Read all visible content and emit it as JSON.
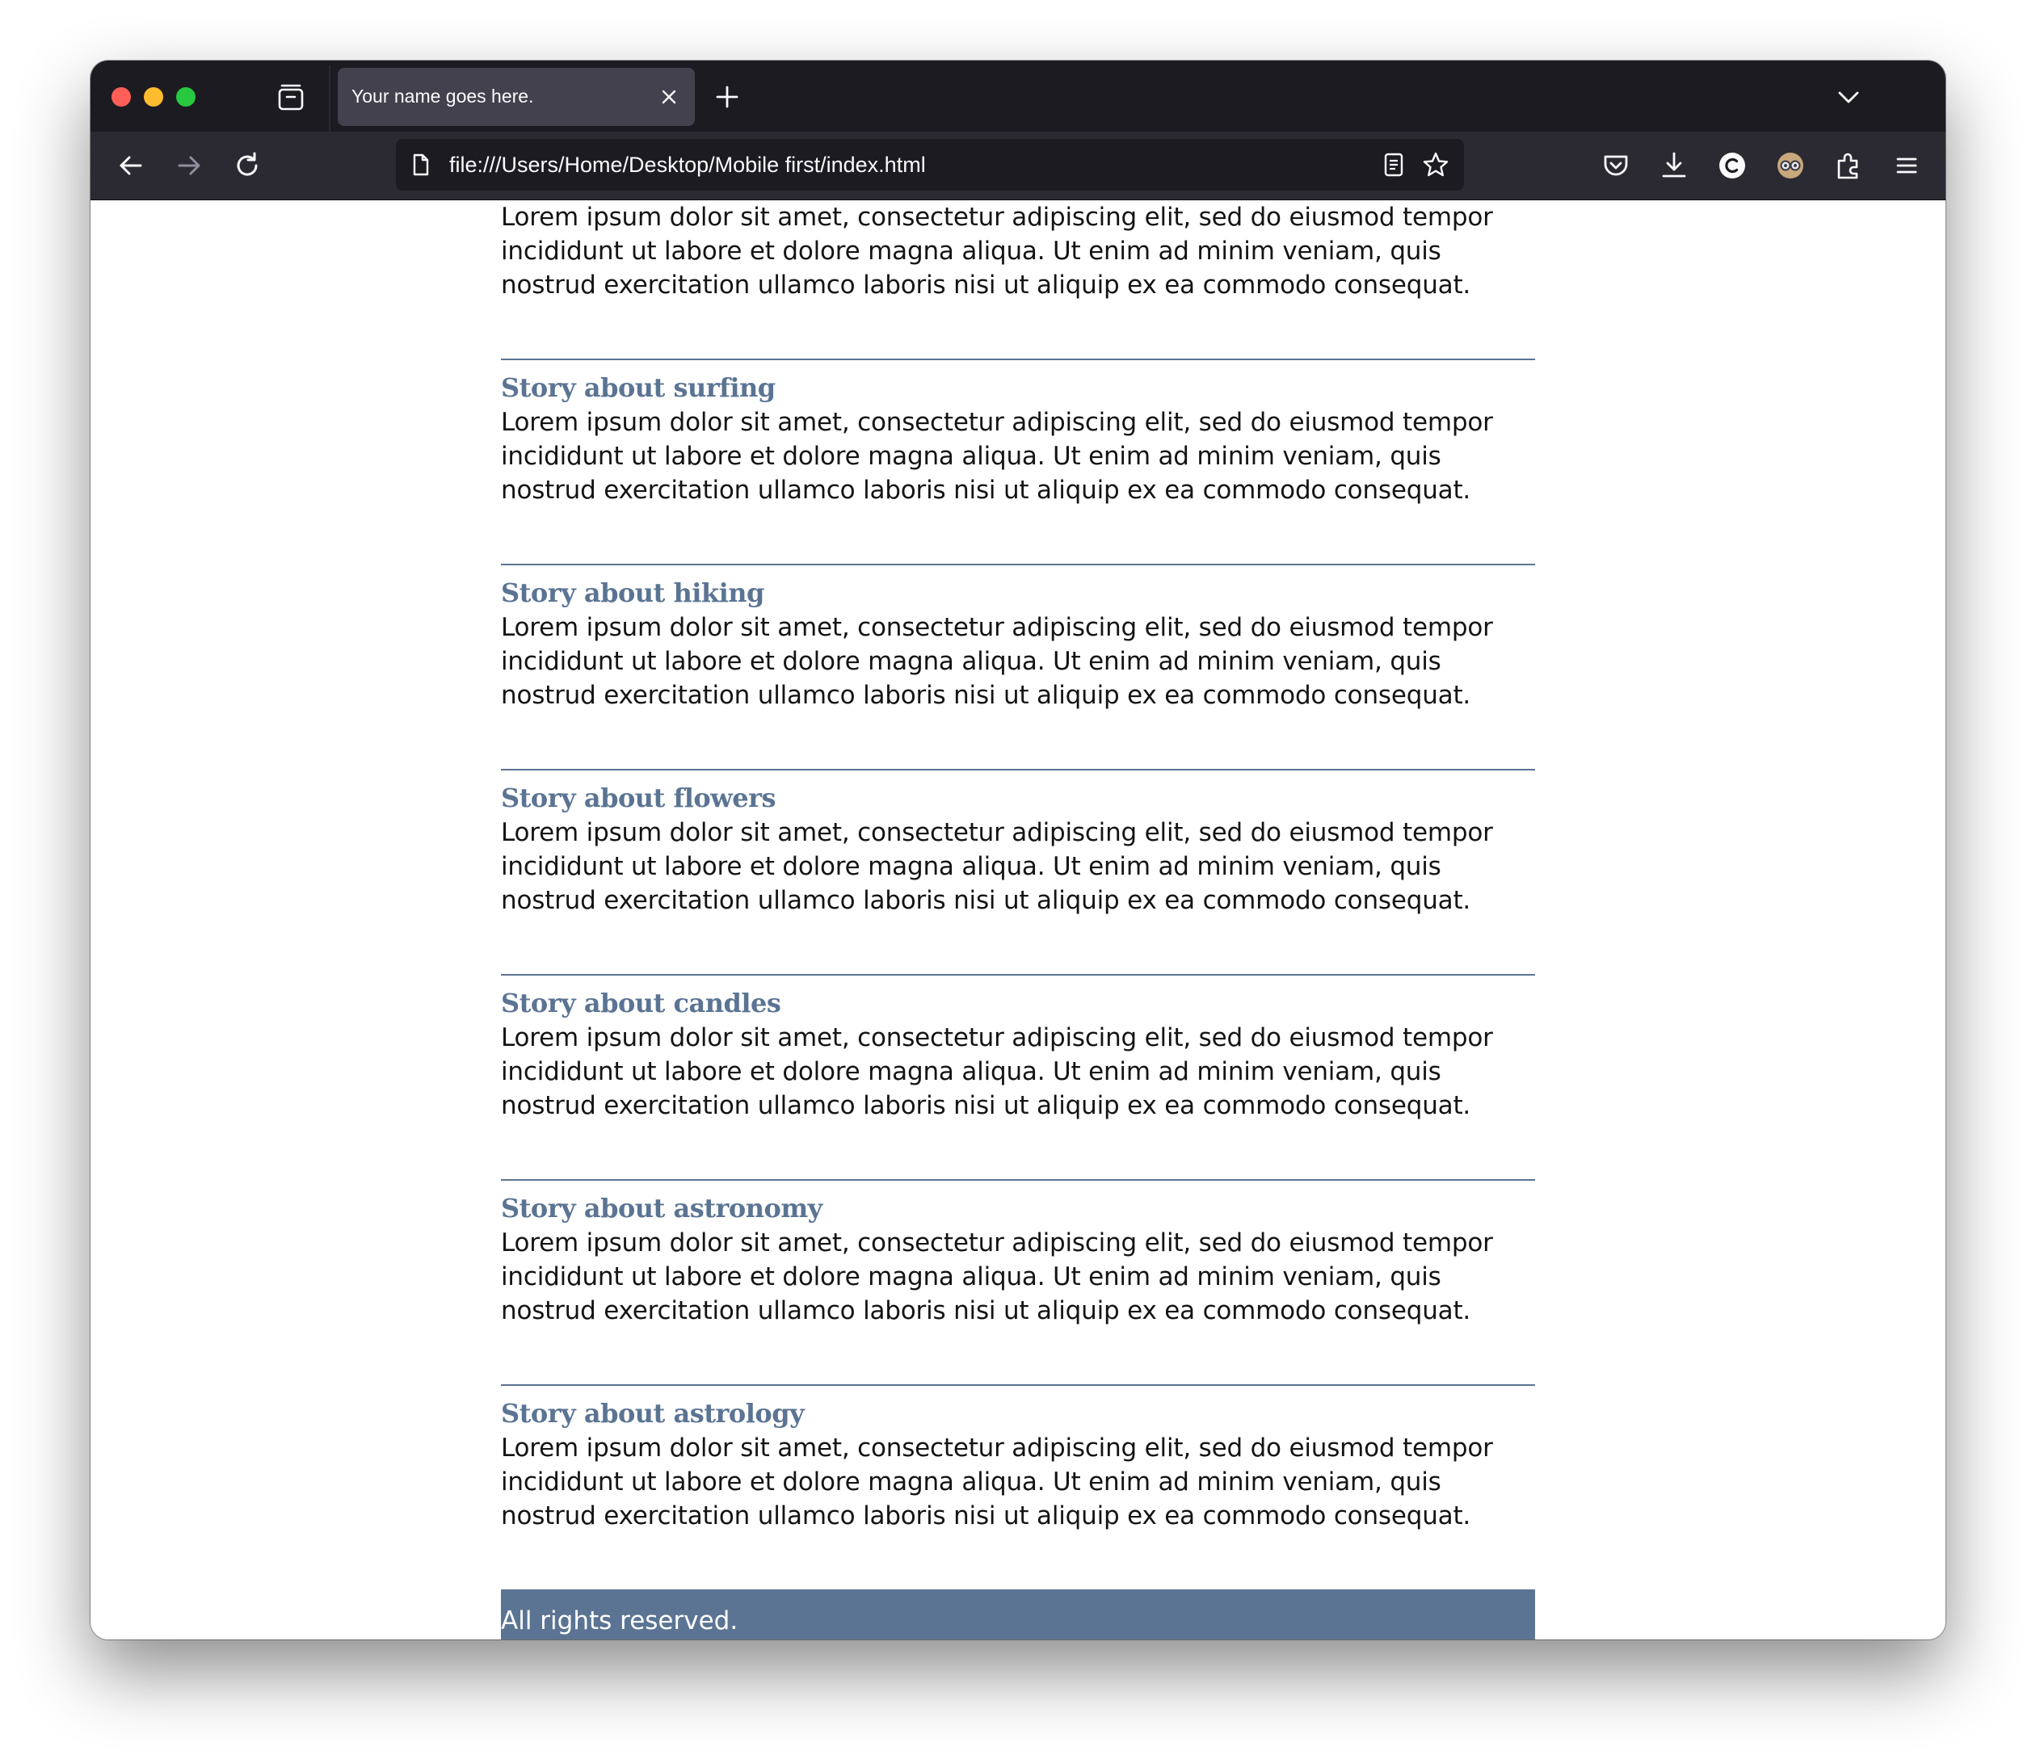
{
  "browser": {
    "tab_title": "Your name goes here.",
    "url": "file:///Users/Home/Desktop/Mobile first/index.html"
  },
  "page": {
    "intro_text": "Lorem ipsum dolor sit amet, consectetur adipiscing elit, sed do eiusmod tempor incididunt ut labore et dolore magna aliqua. Ut enim ad minim veniam, quis nostrud exercitation ullamco laboris nisi ut aliquip ex ea commodo consequat.",
    "stories": [
      {
        "title": "Story about surfing",
        "text": "Lorem ipsum dolor sit amet, consectetur adipiscing elit, sed do eiusmod tempor incididunt ut labore et dolore magna aliqua. Ut enim ad minim veniam, quis nostrud exercitation ullamco laboris nisi ut aliquip ex ea commodo consequat."
      },
      {
        "title": "Story about hiking",
        "text": "Lorem ipsum dolor sit amet, consectetur adipiscing elit, sed do eiusmod tempor incididunt ut labore et dolore magna aliqua. Ut enim ad minim veniam, quis nostrud exercitation ullamco laboris nisi ut aliquip ex ea commodo consequat."
      },
      {
        "title": "Story about flowers",
        "text": "Lorem ipsum dolor sit amet, consectetur adipiscing elit, sed do eiusmod tempor incididunt ut labore et dolore magna aliqua. Ut enim ad minim veniam, quis nostrud exercitation ullamco laboris nisi ut aliquip ex ea commodo consequat."
      },
      {
        "title": "Story about candles",
        "text": "Lorem ipsum dolor sit amet, consectetur adipiscing elit, sed do eiusmod tempor incididunt ut labore et dolore magna aliqua. Ut enim ad minim veniam, quis nostrud exercitation ullamco laboris nisi ut aliquip ex ea commodo consequat."
      },
      {
        "title": "Story about astronomy",
        "text": "Lorem ipsum dolor sit amet, consectetur adipiscing elit, sed do eiusmod tempor incididunt ut labore et dolore magna aliqua. Ut enim ad minim veniam, quis nostrud exercitation ullamco laboris nisi ut aliquip ex ea commodo consequat."
      },
      {
        "title": "Story about astrology",
        "text": "Lorem ipsum dolor sit amet, consectetur adipiscing elit, sed do eiusmod tempor incididunt ut labore et dolore magna aliqua. Ut enim ad minim veniam, quis nostrud exercitation ullamco laboris nisi ut aliquip ex ea commodo consequat."
      }
    ],
    "footer_text": "All rights reserved."
  },
  "colors": {
    "accent": "#5b7493",
    "tabbar_bg": "#1c1b22",
    "toolbar_bg": "#2b2a33",
    "active_tab_bg": "#42414d"
  },
  "icons": {
    "traffic_lights": [
      "close-window-icon",
      "minimize-window-icon",
      "maximize-window-icon"
    ],
    "tabbar": [
      "tab-list-icon",
      "close-tab-icon",
      "plus-icon",
      "chevron-down-icon"
    ],
    "navigation": [
      "arrow-left-icon",
      "arrow-right-icon",
      "reload-icon"
    ],
    "urlbar": [
      "page-icon",
      "reader-view-icon",
      "star-icon"
    ],
    "toolbar_right": [
      "pocket-icon",
      "download-icon",
      "account-icon",
      "extension-avatar-icon",
      "puzzle-icon",
      "hamburger-menu-icon"
    ]
  }
}
